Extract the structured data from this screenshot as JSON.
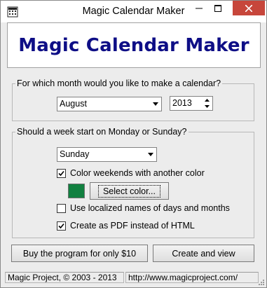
{
  "window": {
    "title": "Magic Calendar Maker",
    "controls": [
      "minimize-icon",
      "maximize-icon",
      "close-icon"
    ]
  },
  "banner": {
    "text": "Magic Calendar Maker",
    "color": "#0e0e86"
  },
  "month_group": {
    "legend": "For which month would you like to make a calendar?",
    "month_value": "August",
    "year_value": "2013"
  },
  "week_group": {
    "legend": "Should a week start on Monday or Sunday?",
    "start_day_value": "Sunday",
    "color_weekends": {
      "label": "Color weekends with another color",
      "checked": true
    },
    "weekend_color": "#118040",
    "select_color_label": "Select color...",
    "localized_names": {
      "label": "Use localized names of days and months",
      "checked": false
    },
    "pdf_output": {
      "label": "Create as PDF instead of HTML",
      "checked": true
    }
  },
  "actions": {
    "buy_label": "Buy the program for only $10",
    "create_label": "Create and view"
  },
  "statusbar": {
    "copyright": "Magic Project, © 2003 - 2013",
    "url": "http://www.magicproject.com/"
  }
}
